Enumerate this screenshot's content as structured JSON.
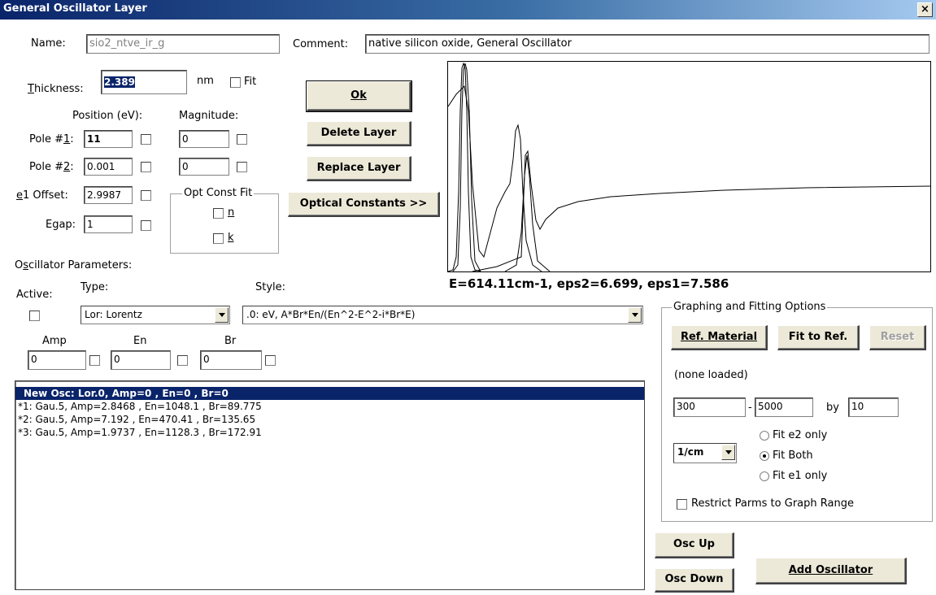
{
  "window": {
    "title": "General Oscillator Layer",
    "close_label": "×"
  },
  "name": {
    "label": "Name:",
    "value": "sio2_ntve_ir_g"
  },
  "comment": {
    "label": "Comment:",
    "value": "native silicon oxide, General Oscillator"
  },
  "thickness": {
    "label_pre": "",
    "label_ul": "T",
    "label_post": "hickness:",
    "value": "2.389",
    "unit": "nm",
    "fit_label": "Fit"
  },
  "poles": {
    "position_header": "Position (eV):",
    "magnitude_header": "Magnitude:",
    "pole1": {
      "label_pre": "Pole #",
      "label_ul": "1",
      "label_post": ":",
      "position": "11",
      "magnitude": "0"
    },
    "pole2": {
      "label_pre": "Pole #",
      "label_ul": "2",
      "label_post": ":",
      "position": "0.001",
      "magnitude": "0"
    }
  },
  "e1_offset": {
    "label_ul": "e",
    "label_post": "1 Offset:",
    "value": "2.9987"
  },
  "egap": {
    "label": "Egap:",
    "value": "1"
  },
  "opt_const_fit": {
    "title": "Opt Const Fit",
    "n": "n",
    "k": "k"
  },
  "buttons": {
    "ok": "Ok",
    "delete": "Delete Layer",
    "replace": "Replace Layer",
    "optical": "Optical Constants >>",
    "osc_up": "Osc Up",
    "osc_down": "Osc Down",
    "add_osc": "Add Oscillator",
    "ref_material": "Ref. Material",
    "fit_to_ref": "Fit to Ref.",
    "reset": "Reset"
  },
  "graph_readout": "E=614.11cm-1, eps2=6.699, eps1=7.586",
  "osc_params": {
    "section_label_pre": "O",
    "section_label_ul": "s",
    "section_label_post": "cillator Parameters:",
    "active_label": "Active:",
    "type_label": "Type:",
    "style_label": "Style:",
    "type_value": "Lor: Lorentz",
    "style_value": ".0: eV, A*Br*En/(En^2-E^2-i*Br*E)",
    "amp_label": "Amp",
    "en_label": "En",
    "br_label": "Br",
    "amp_value": "0",
    "en_value": "0",
    "br_value": "0"
  },
  "oscillator_list": [
    "New Osc: Lor.0, Amp=0 , En=0 , Br=0",
    "*1: Gau.5, Amp=2.8468 , En=1048.1 , Br=89.775",
    "*2: Gau.5, Amp=7.192 , En=470.41 , Br=135.65",
    "*3: Gau.5, Amp=1.9737 , En=1128.3 , Br=172.91"
  ],
  "graphing": {
    "title": "Graphing and Fitting Options",
    "none_loaded": "(none loaded)",
    "range_from": "300",
    "range_to": "5000",
    "dash": "-",
    "by_label": "by",
    "step": "10",
    "units": "1/cm",
    "fit_e2": "Fit e2 only",
    "fit_both": "Fit Both",
    "fit_e1": "Fit e1 only",
    "selected_fit": "Fit Both",
    "restrict_label": "Restrict Parms to Graph Range"
  }
}
